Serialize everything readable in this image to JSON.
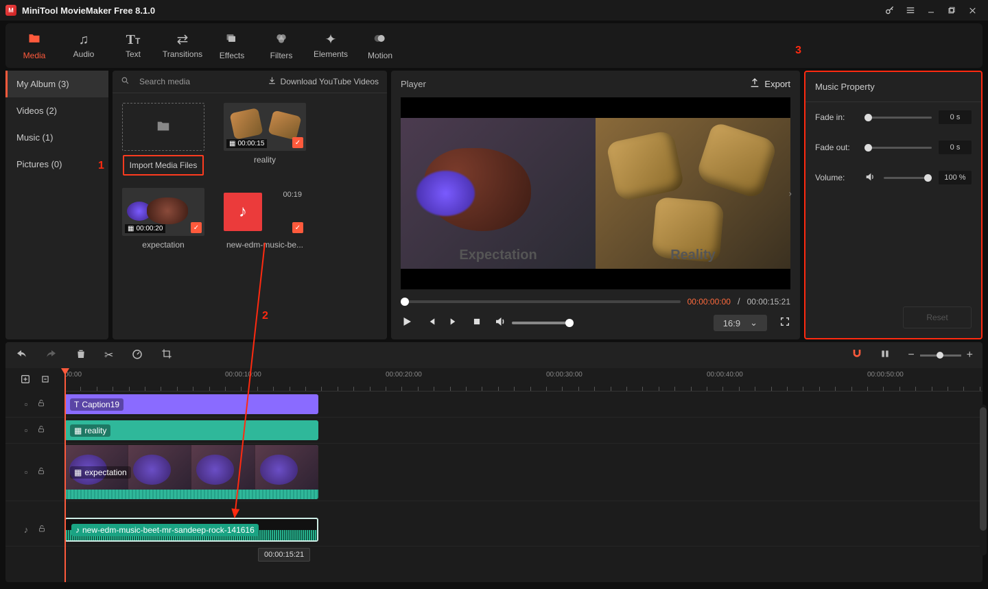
{
  "app": {
    "title": "MiniTool MovieMaker Free 8.1.0"
  },
  "ribbon": [
    {
      "id": "media",
      "label": "Media",
      "active": true
    },
    {
      "id": "audio",
      "label": "Audio"
    },
    {
      "id": "text",
      "label": "Text"
    },
    {
      "id": "transitions",
      "label": "Transitions"
    },
    {
      "id": "effects",
      "label": "Effects"
    },
    {
      "id": "filters",
      "label": "Filters"
    },
    {
      "id": "elements",
      "label": "Elements"
    },
    {
      "id": "motion",
      "label": "Motion"
    }
  ],
  "library_tabs": {
    "my_album": "My Album (3)",
    "videos": "Videos (2)",
    "music": "Music (1)",
    "pictures": "Pictures (0)"
  },
  "media_pane": {
    "search_placeholder": "Search media",
    "download_label": "Download YouTube Videos",
    "import_button": "Import Media Files",
    "items": [
      {
        "name": "reality",
        "duration": "00:00:15",
        "kind": "video"
      },
      {
        "name": "expectation",
        "duration": "00:00:20",
        "kind": "video"
      },
      {
        "name": "new-edm-music-be...",
        "duration": "00:19",
        "kind": "audio"
      }
    ]
  },
  "player": {
    "title": "Player",
    "export": "Export",
    "caption_left": "Expectation",
    "caption_right": "Reality",
    "time_current": "00:00:00:00",
    "time_total": "00:00:15:21",
    "aspect": "16:9"
  },
  "music_property": {
    "title": "Music Property",
    "fade_in_label": "Fade in:",
    "fade_in_value": "0 s",
    "fade_out_label": "Fade out:",
    "fade_out_value": "0 s",
    "volume_label": "Volume:",
    "volume_value": "100 %",
    "reset": "Reset"
  },
  "annotations": {
    "one": "1",
    "two": "2",
    "three": "3"
  },
  "timeline": {
    "ruler": [
      "00:00",
      "00:00:10:00",
      "00:00:20:00",
      "00:00:30:00",
      "00:00:40:00",
      "00:00:50:00"
    ],
    "tooltip": "00:00:15:21",
    "tracks": {
      "caption_clip": "Caption19",
      "reality_clip": "reality",
      "expectation_clip": "expectation",
      "audio_clip": "new-edm-music-beet-mr-sandeep-rock-141616"
    }
  }
}
